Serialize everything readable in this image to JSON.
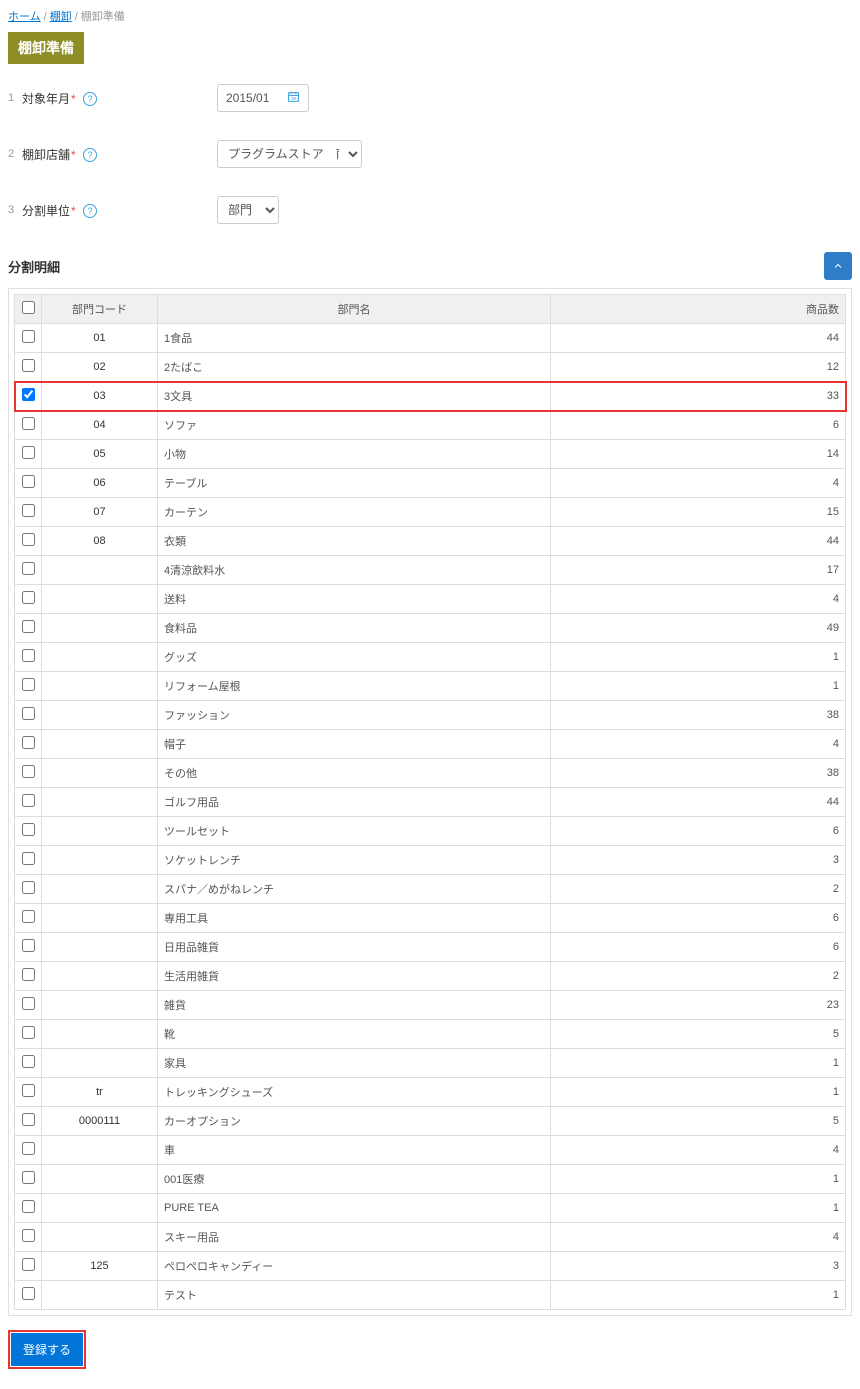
{
  "breadcrumb": {
    "home": "ホーム",
    "stock": "棚卸",
    "current": "棚卸準備"
  },
  "page_title": "棚卸準備",
  "form": {
    "row1": {
      "num": "1",
      "label": "対象年月",
      "value": "2015/01"
    },
    "row2": {
      "num": "2",
      "label": "棚卸店舗",
      "option": "プラグラムストア　南堀江店"
    },
    "row3": {
      "num": "3",
      "label": "分割単位",
      "option": "部門"
    }
  },
  "section_title": "分割明細",
  "table": {
    "headers": {
      "code": "部門コード",
      "name": "部門名",
      "count": "商品数"
    },
    "rows": [
      {
        "checked": false,
        "code": "01",
        "name": "1食品",
        "count": "44",
        "hl": false
      },
      {
        "checked": false,
        "code": "02",
        "name": "2たばこ",
        "count": "12",
        "hl": false
      },
      {
        "checked": true,
        "code": "03",
        "name": "3文具",
        "count": "33",
        "hl": true
      },
      {
        "checked": false,
        "code": "04",
        "name": "ソファ",
        "count": "6",
        "hl": false
      },
      {
        "checked": false,
        "code": "05",
        "name": "小物",
        "count": "14",
        "hl": false
      },
      {
        "checked": false,
        "code": "06",
        "name": "テーブル",
        "count": "4",
        "hl": false
      },
      {
        "checked": false,
        "code": "07",
        "name": "カーテン",
        "count": "15",
        "hl": false
      },
      {
        "checked": false,
        "code": "08",
        "name": "衣類",
        "count": "44",
        "hl": false
      },
      {
        "checked": false,
        "code": "",
        "name": "4清涼飲料水",
        "count": "17",
        "hl": false
      },
      {
        "checked": false,
        "code": "",
        "name": "送料",
        "count": "4",
        "hl": false
      },
      {
        "checked": false,
        "code": "",
        "name": "食料品",
        "count": "49",
        "hl": false
      },
      {
        "checked": false,
        "code": "",
        "name": "グッズ",
        "count": "1",
        "hl": false
      },
      {
        "checked": false,
        "code": "",
        "name": "リフォーム屋根",
        "count": "1",
        "hl": false
      },
      {
        "checked": false,
        "code": "",
        "name": "ファッション",
        "count": "38",
        "hl": false
      },
      {
        "checked": false,
        "code": "",
        "name": "帽子",
        "count": "4",
        "hl": false
      },
      {
        "checked": false,
        "code": "",
        "name": "その他",
        "count": "38",
        "hl": false
      },
      {
        "checked": false,
        "code": "",
        "name": "ゴルフ用品",
        "count": "44",
        "hl": false
      },
      {
        "checked": false,
        "code": "",
        "name": "ツールセット",
        "count": "6",
        "hl": false
      },
      {
        "checked": false,
        "code": "",
        "name": "ソケットレンチ",
        "count": "3",
        "hl": false
      },
      {
        "checked": false,
        "code": "",
        "name": "スパナ／めがねレンチ",
        "count": "2",
        "hl": false
      },
      {
        "checked": false,
        "code": "",
        "name": "専用工具",
        "count": "6",
        "hl": false
      },
      {
        "checked": false,
        "code": "",
        "name": "日用品雑貨",
        "count": "6",
        "hl": false
      },
      {
        "checked": false,
        "code": "",
        "name": "生活用雑貨",
        "count": "2",
        "hl": false
      },
      {
        "checked": false,
        "code": "",
        "name": "雑貨",
        "count": "23",
        "hl": false
      },
      {
        "checked": false,
        "code": "",
        "name": "靴",
        "count": "5",
        "hl": false
      },
      {
        "checked": false,
        "code": "",
        "name": "家具",
        "count": "1",
        "hl": false
      },
      {
        "checked": false,
        "code": "tr",
        "name": "トレッキングシューズ",
        "count": "1",
        "hl": false
      },
      {
        "checked": false,
        "code": "0000111",
        "name": "カーオプション",
        "count": "5",
        "hl": false
      },
      {
        "checked": false,
        "code": "",
        "name": "車",
        "count": "4",
        "hl": false
      },
      {
        "checked": false,
        "code": "",
        "name": "001医療",
        "count": "1",
        "hl": false
      },
      {
        "checked": false,
        "code": "",
        "name": "PURE TEA",
        "count": "1",
        "hl": false
      },
      {
        "checked": false,
        "code": "",
        "name": "スキー用品",
        "count": "4",
        "hl": false
      },
      {
        "checked": false,
        "code": "125",
        "name": "ペロペロキャンディー",
        "count": "3",
        "hl": false
      },
      {
        "checked": false,
        "code": "",
        "name": "テスト",
        "count": "1",
        "hl": false
      }
    ]
  },
  "submit_label": "登録する"
}
